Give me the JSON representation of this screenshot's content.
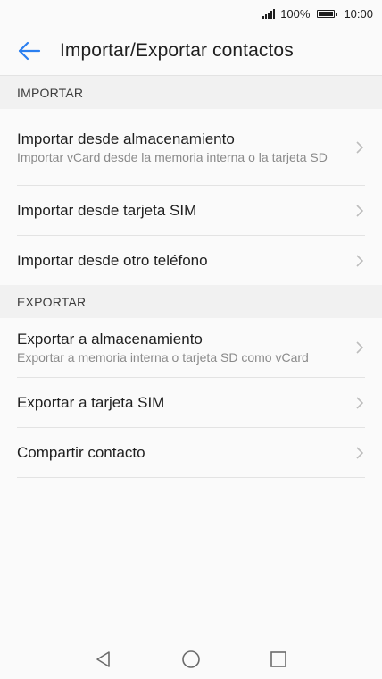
{
  "status_bar": {
    "battery_percent": "100%",
    "time": "10:00",
    "icons": [
      "signal-icon",
      "battery-icon"
    ]
  },
  "app_bar": {
    "title": "Importar/Exportar contactos",
    "back_icon": "arrow-left-icon"
  },
  "sections": {
    "import": {
      "header": "IMPORTAR",
      "items": [
        {
          "label": "Importar desde almacenamiento",
          "subtitle": "Importar vCard desde la memoria interna o la tarjeta SD"
        },
        {
          "label": "Importar desde tarjeta SIM"
        },
        {
          "label": "Importar desde otro teléfono"
        }
      ]
    },
    "export": {
      "header": "EXPORTAR",
      "items": [
        {
          "label": "Exportar a almacenamiento",
          "subtitle": "Exportar a memoria interna o tarjeta SD como vCard"
        },
        {
          "label": "Exportar a tarjeta SIM"
        },
        {
          "label": "Compartir contacto"
        }
      ]
    }
  },
  "nav_bar": {
    "icons": [
      "back-triangle-icon",
      "home-circle-icon",
      "recents-square-icon"
    ]
  },
  "colors": {
    "accent": "#2a7ff0",
    "background": "#fafafa",
    "section_header_bg": "#f1f1f1",
    "divider": "#e3e3e3",
    "subtitle": "#8a8a8a"
  }
}
